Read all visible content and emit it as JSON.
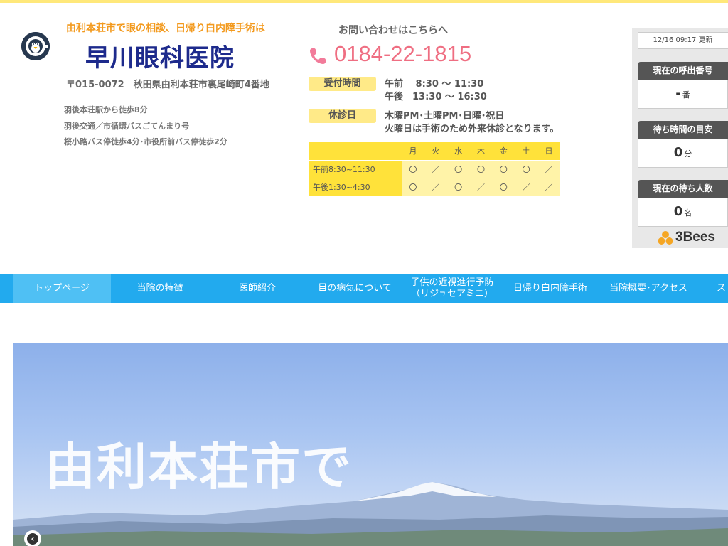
{
  "header": {
    "tagline": "由利本荘市で眼の相談、日帰り白内障手術は",
    "clinic_name": "早川眼科医院",
    "address": "〒015-0072　秋田県由利本荘市裏尾崎町4番地",
    "access": [
      "羽後本荘駅から徒歩8分",
      "羽後交通／市循環バスごてんまり号",
      "桜小路バス停徒歩4分･市役所前バス停徒歩2分"
    ]
  },
  "contact": {
    "label": "お問い合わせはこちらへ",
    "phone": "0184-22-1815",
    "hours_label": "受付時間",
    "hours_am": "午前　 8:30 〜 11:30",
    "hours_pm": "午後　13:30 〜 16:30",
    "closed_label": "休診日",
    "closed_line1": "木曜PM･土曜PM･日曜･祝日",
    "closed_line2": "火曜日は手術のため外来休診となります。"
  },
  "schedule": {
    "days": [
      "月",
      "火",
      "水",
      "木",
      "金",
      "土",
      "日"
    ],
    "rows": [
      {
        "label": "午前8:30~11:30",
        "cells": [
          "〇",
          "／",
          "〇",
          "〇",
          "〇",
          "〇",
          "／"
        ]
      },
      {
        "label": "午後1:30~4:30",
        "cells": [
          "〇",
          "／",
          "〇",
          "／",
          "〇",
          "／",
          "／"
        ]
      }
    ]
  },
  "widget": {
    "updated": "12/16 09:17 更新",
    "calling_label": "現在の呼出番号",
    "calling_value": "-",
    "calling_unit": "番",
    "wait_label": "待ち時間の目安",
    "wait_value": "0",
    "wait_unit": "分",
    "people_label": "現在の待ち人数",
    "people_value": "0",
    "people_unit": "名",
    "brand": "3Bees",
    "brand_color": "#f5a623"
  },
  "nav": {
    "items": [
      {
        "label": "トップページ"
      },
      {
        "label": "当院の特徴"
      },
      {
        "label": "医師紹介"
      },
      {
        "label": "目の病気について"
      },
      {
        "label": "子供の近視進行予防",
        "sub": "（リジュセアミニ）"
      },
      {
        "label": "日帰り白内障手術"
      },
      {
        "label": "当院概要･アクセス"
      },
      {
        "label": "ス"
      }
    ]
  },
  "hero": {
    "text": "由利本荘市で",
    "prev_icon": "chevron-left-icon"
  },
  "colors": {
    "accent_yellow": "#ffe23a",
    "nav_blue": "#22aaee",
    "phone_pink": "#ef6e82",
    "tagline_orange": "#f39a1e",
    "title_navy": "#1d2a8c"
  }
}
